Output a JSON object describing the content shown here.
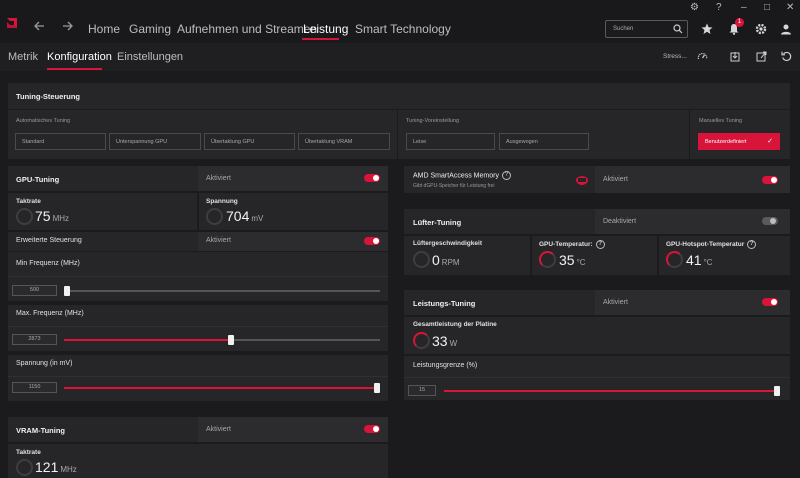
{
  "nav": {
    "tabs": [
      "Home",
      "Gaming",
      "Aufnehmen und Streamen",
      "Leistung",
      "Smart Technology"
    ],
    "search_placeholder": "Suchen",
    "notification_count": "1"
  },
  "subnav": {
    "tabs": [
      "Metrik",
      "Konfiguration",
      "Einstellungen"
    ],
    "stress_label": "Stress..."
  },
  "tuning": {
    "title": "Tuning-Steuerung",
    "auto_label": "Automatisches Tuning",
    "auto_options": [
      "Standard",
      "Unterspannung GPU",
      "Übertaktung GPU",
      "Übertaktung VRAM"
    ],
    "preset_label": "Tuning-Voreinstellung",
    "preset_options": [
      "Leise",
      "Ausgewogen"
    ],
    "manual_label": "Manuelles Tuning",
    "manual_option": "Benutzerdefiniert"
  },
  "gpu_tuning": {
    "title": "GPU-Tuning",
    "status": "Aktiviert",
    "clock_label": "Taktrate",
    "clock_value": "75",
    "clock_unit": "MHz",
    "voltage_label": "Spannung",
    "voltage_value": "704",
    "voltage_unit": "mV",
    "advanced_label": "Erweiterte Steuerung",
    "advanced_status": "Aktiviert",
    "min_freq_label": "Min Frequenz (MHz)",
    "min_freq_value": "500",
    "min_freq_level": 0.0,
    "max_freq_label": "Max. Frequenz (MHz)",
    "max_freq_value": "2873",
    "max_freq_level": 0.53,
    "voltage_mv_label": "Spannung (in mV)",
    "voltage_mv_value": "1150",
    "voltage_mv_level": 1.0
  },
  "vram_tuning": {
    "title": "VRAM-Tuning",
    "status": "Aktiviert",
    "clock_label": "Taktrate",
    "clock_value": "121",
    "clock_unit": "MHz"
  },
  "sam": {
    "title": "AMD SmartAccess Memory",
    "subtitle": "Gibt dGPU-Speicher für Leistung frei",
    "status": "Aktiviert"
  },
  "fan_tuning": {
    "title": "Lüfter-Tuning",
    "status": "Deaktiviert",
    "speed_label": "Lüftergeschwindigkeit",
    "speed_value": "0",
    "speed_unit": "RPM",
    "gpu_temp_label": "GPU-Temperatur:",
    "gpu_temp_value": "35",
    "gpu_temp_unit": "°C",
    "hotspot_label": "GPU-Hotspot-Temperatur",
    "hotspot_value": "41",
    "hotspot_unit": "°C"
  },
  "power_tuning": {
    "title": "Leistungs-Tuning",
    "status": "Aktiviert",
    "board_power_label": "Gesamtleistung der Platine",
    "board_power_value": "33",
    "board_power_unit": "W",
    "limit_label": "Leistungsgrenze (%)",
    "limit_value": "15",
    "limit_level": 1.0
  },
  "colors": {
    "accent": "#d8143a",
    "background": "#1b1b1d",
    "panel": "#262628"
  }
}
